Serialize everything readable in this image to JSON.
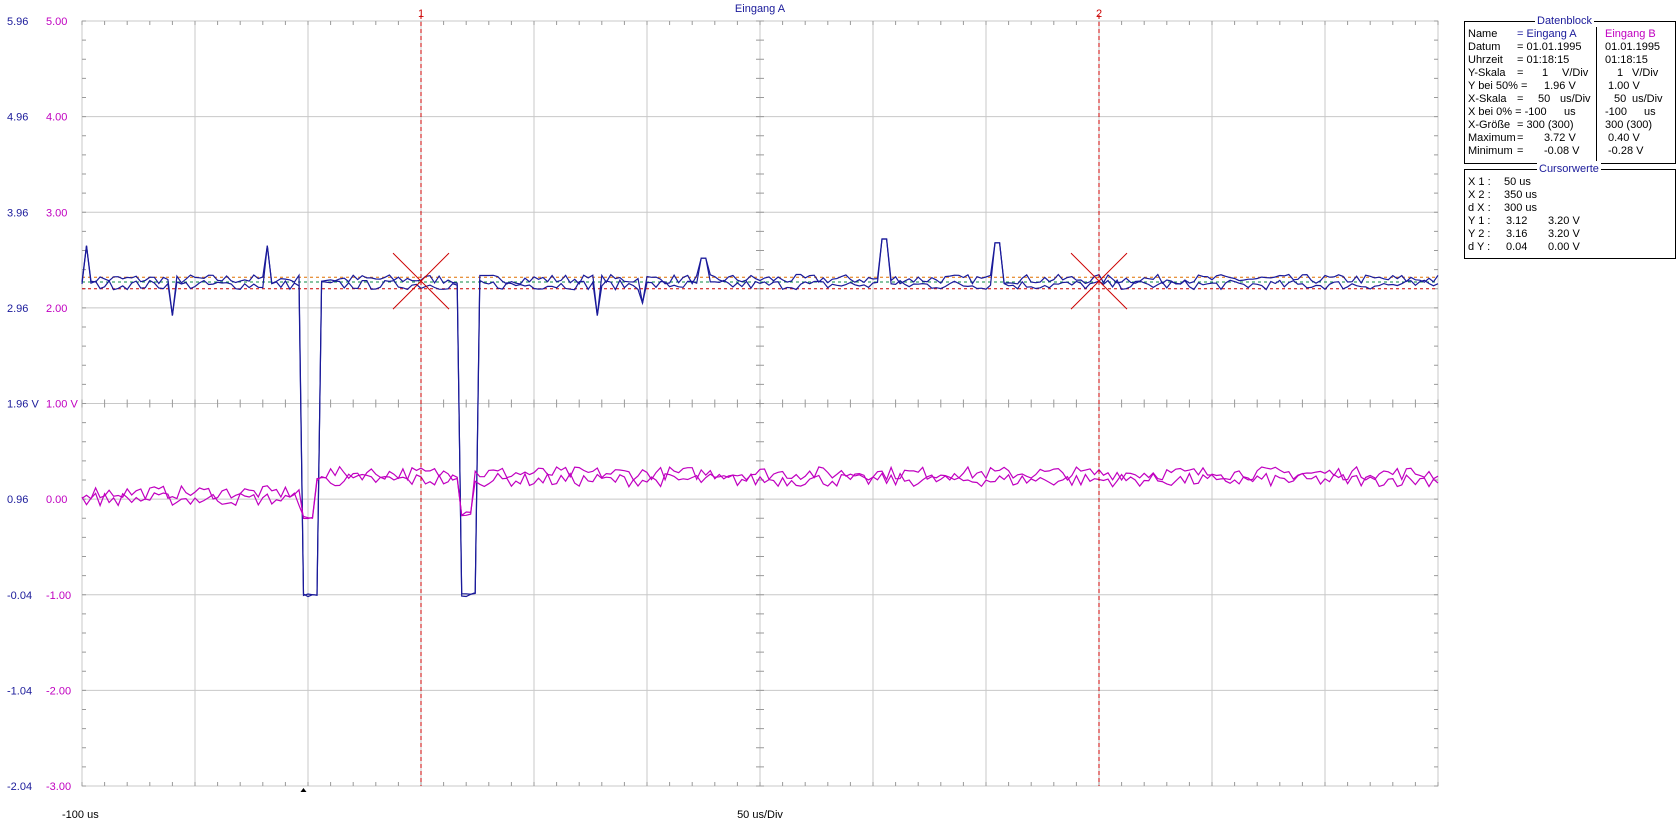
{
  "chart_data": {
    "type": "line",
    "title": "Eingang A",
    "x_start_label": "-100 us",
    "x_div_label": "50 us/Div",
    "xlim": [
      -100,
      500
    ],
    "x_divisions": 12,
    "y_divisions": 8,
    "cursor_labels": [
      "1",
      "2"
    ],
    "cursors_x": [
      50,
      350
    ],
    "left_axis": {
      "ticks": [
        "5.96",
        "4.96",
        "3.96",
        "2.96",
        "1.96 V",
        "0.96",
        "-0.04",
        "-1.04",
        "-2.04"
      ]
    },
    "right_axis": {
      "ticks": [
        "5.00",
        "4.00",
        "3.00",
        "2.00",
        "1.00 V",
        "0.00",
        "-1.00",
        "-2.00",
        "-3.00"
      ]
    },
    "ylim": [
      -3,
      5
    ],
    "series": [
      {
        "name": "Eingang A",
        "color": "#1a1a9a",
        "baseline": 2.28,
        "offset": 0.04,
        "dips": [
          [
            -2,
            5.5,
            -1.0
          ],
          [
            68,
            75.5,
            -1.0
          ]
        ],
        "spikes": [
          [
            -98,
            2.65
          ],
          [
            -60,
            1.92
          ],
          [
            -18,
            2.65
          ],
          [
            175,
            2.52
          ],
          [
            255,
            2.72
          ],
          [
            305,
            2.68
          ],
          [
            128,
            1.92
          ],
          [
            148,
            2.05
          ]
        ]
      },
      {
        "name": "Eingang B",
        "color": "#c000c0",
        "start": 0.05,
        "level": 0.25,
        "offset": 0.05,
        "dips": [
          [
            -2,
            3,
            -0.2
          ],
          [
            68,
            72,
            -0.15
          ]
        ]
      }
    ],
    "ref_lines": [
      {
        "y": 2.27,
        "color": "#0b8b45",
        "dash": true
      },
      {
        "y": 2.32,
        "color": "#e07000",
        "dash": true
      },
      {
        "y": 2.2,
        "color": "#cc0000",
        "dash": true
      }
    ]
  },
  "datenblock": {
    "title": "Datenblock",
    "rows": [
      [
        "Name",
        "= Eingang A",
        "Eingang B"
      ],
      [
        "Datum",
        "= 01.01.1995",
        "01.01.1995"
      ],
      [
        "Uhrzeit",
        "= 01:18:15",
        "01:18:15"
      ],
      [
        "Y-Skala",
        "=",
        "1",
        "V/Div",
        "1",
        "V/Div"
      ],
      [
        "Y bei 50% =",
        "1.96 V",
        "1.00 V"
      ],
      [
        "X-Skala",
        "=",
        "50",
        "us/Div",
        "50",
        "us/Div"
      ],
      [
        "X bei 0% = -100",
        "us",
        "-100",
        "us"
      ],
      [
        "X-Größe",
        "= 300 (300)",
        "300 (300)"
      ],
      [
        "Maximum",
        "=",
        "3.72 V",
        "0.40 V"
      ],
      [
        "Minimum",
        "=",
        "-0.08 V",
        "-0.28 V"
      ]
    ]
  },
  "cursorwerte": {
    "title": "Cursorwerte",
    "rows": [
      [
        "X 1 :",
        "50 us"
      ],
      [
        "X 2 :",
        "350 us"
      ],
      [
        "d X :",
        "300 us"
      ],
      [
        "Y 1 :",
        "3.12",
        "3.20 V"
      ],
      [
        "Y 2 :",
        "3.16",
        "3.20 V"
      ],
      [
        "d Y :",
        "0.04",
        "0.00 V"
      ]
    ]
  },
  "colors": {
    "channel_a": "#1a1a9a",
    "channel_b": "#c000c0",
    "cursor": "#cc0000",
    "grid": "#c8c8c8"
  }
}
